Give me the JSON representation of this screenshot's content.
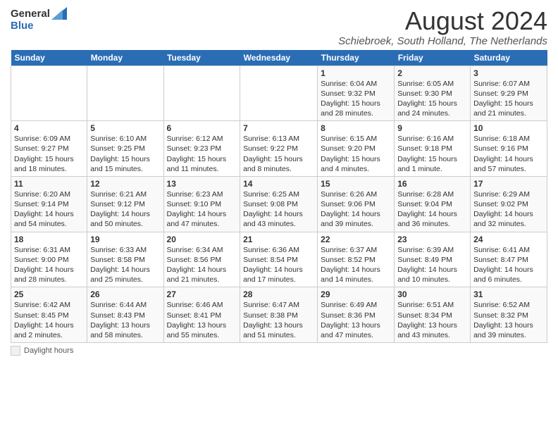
{
  "header": {
    "logo": {
      "general": "General",
      "blue": "Blue"
    },
    "title": "August 2024",
    "location": "Schiebroek, South Holland, The Netherlands"
  },
  "calendar": {
    "weekdays": [
      "Sunday",
      "Monday",
      "Tuesday",
      "Wednesday",
      "Thursday",
      "Friday",
      "Saturday"
    ],
    "weeks": [
      [
        {
          "day": "",
          "info": ""
        },
        {
          "day": "",
          "info": ""
        },
        {
          "day": "",
          "info": ""
        },
        {
          "day": "",
          "info": ""
        },
        {
          "day": "1",
          "info": "Sunrise: 6:04 AM\nSunset: 9:32 PM\nDaylight: 15 hours and 28 minutes."
        },
        {
          "day": "2",
          "info": "Sunrise: 6:05 AM\nSunset: 9:30 PM\nDaylight: 15 hours and 24 minutes."
        },
        {
          "day": "3",
          "info": "Sunrise: 6:07 AM\nSunset: 9:29 PM\nDaylight: 15 hours and 21 minutes."
        }
      ],
      [
        {
          "day": "4",
          "info": "Sunrise: 6:09 AM\nSunset: 9:27 PM\nDaylight: 15 hours and 18 minutes."
        },
        {
          "day": "5",
          "info": "Sunrise: 6:10 AM\nSunset: 9:25 PM\nDaylight: 15 hours and 15 minutes."
        },
        {
          "day": "6",
          "info": "Sunrise: 6:12 AM\nSunset: 9:23 PM\nDaylight: 15 hours and 11 minutes."
        },
        {
          "day": "7",
          "info": "Sunrise: 6:13 AM\nSunset: 9:22 PM\nDaylight: 15 hours and 8 minutes."
        },
        {
          "day": "8",
          "info": "Sunrise: 6:15 AM\nSunset: 9:20 PM\nDaylight: 15 hours and 4 minutes."
        },
        {
          "day": "9",
          "info": "Sunrise: 6:16 AM\nSunset: 9:18 PM\nDaylight: 15 hours and 1 minute."
        },
        {
          "day": "10",
          "info": "Sunrise: 6:18 AM\nSunset: 9:16 PM\nDaylight: 14 hours and 57 minutes."
        }
      ],
      [
        {
          "day": "11",
          "info": "Sunrise: 6:20 AM\nSunset: 9:14 PM\nDaylight: 14 hours and 54 minutes."
        },
        {
          "day": "12",
          "info": "Sunrise: 6:21 AM\nSunset: 9:12 PM\nDaylight: 14 hours and 50 minutes."
        },
        {
          "day": "13",
          "info": "Sunrise: 6:23 AM\nSunset: 9:10 PM\nDaylight: 14 hours and 47 minutes."
        },
        {
          "day": "14",
          "info": "Sunrise: 6:25 AM\nSunset: 9:08 PM\nDaylight: 14 hours and 43 minutes."
        },
        {
          "day": "15",
          "info": "Sunrise: 6:26 AM\nSunset: 9:06 PM\nDaylight: 14 hours and 39 minutes."
        },
        {
          "day": "16",
          "info": "Sunrise: 6:28 AM\nSunset: 9:04 PM\nDaylight: 14 hours and 36 minutes."
        },
        {
          "day": "17",
          "info": "Sunrise: 6:29 AM\nSunset: 9:02 PM\nDaylight: 14 hours and 32 minutes."
        }
      ],
      [
        {
          "day": "18",
          "info": "Sunrise: 6:31 AM\nSunset: 9:00 PM\nDaylight: 14 hours and 28 minutes."
        },
        {
          "day": "19",
          "info": "Sunrise: 6:33 AM\nSunset: 8:58 PM\nDaylight: 14 hours and 25 minutes."
        },
        {
          "day": "20",
          "info": "Sunrise: 6:34 AM\nSunset: 8:56 PM\nDaylight: 14 hours and 21 minutes."
        },
        {
          "day": "21",
          "info": "Sunrise: 6:36 AM\nSunset: 8:54 PM\nDaylight: 14 hours and 17 minutes."
        },
        {
          "day": "22",
          "info": "Sunrise: 6:37 AM\nSunset: 8:52 PM\nDaylight: 14 hours and 14 minutes."
        },
        {
          "day": "23",
          "info": "Sunrise: 6:39 AM\nSunset: 8:49 PM\nDaylight: 14 hours and 10 minutes."
        },
        {
          "day": "24",
          "info": "Sunrise: 6:41 AM\nSunset: 8:47 PM\nDaylight: 14 hours and 6 minutes."
        }
      ],
      [
        {
          "day": "25",
          "info": "Sunrise: 6:42 AM\nSunset: 8:45 PM\nDaylight: 14 hours and 2 minutes."
        },
        {
          "day": "26",
          "info": "Sunrise: 6:44 AM\nSunset: 8:43 PM\nDaylight: 13 hours and 58 minutes."
        },
        {
          "day": "27",
          "info": "Sunrise: 6:46 AM\nSunset: 8:41 PM\nDaylight: 13 hours and 55 minutes."
        },
        {
          "day": "28",
          "info": "Sunrise: 6:47 AM\nSunset: 8:38 PM\nDaylight: 13 hours and 51 minutes."
        },
        {
          "day": "29",
          "info": "Sunrise: 6:49 AM\nSunset: 8:36 PM\nDaylight: 13 hours and 47 minutes."
        },
        {
          "day": "30",
          "info": "Sunrise: 6:51 AM\nSunset: 8:34 PM\nDaylight: 13 hours and 43 minutes."
        },
        {
          "day": "31",
          "info": "Sunrise: 6:52 AM\nSunset: 8:32 PM\nDaylight: 13 hours and 39 minutes."
        }
      ]
    ]
  },
  "legend": {
    "text": "Daylight hours"
  },
  "colors": {
    "header_bg": "#2a6db5",
    "header_text": "#ffffff",
    "accent": "#2a6db5"
  }
}
